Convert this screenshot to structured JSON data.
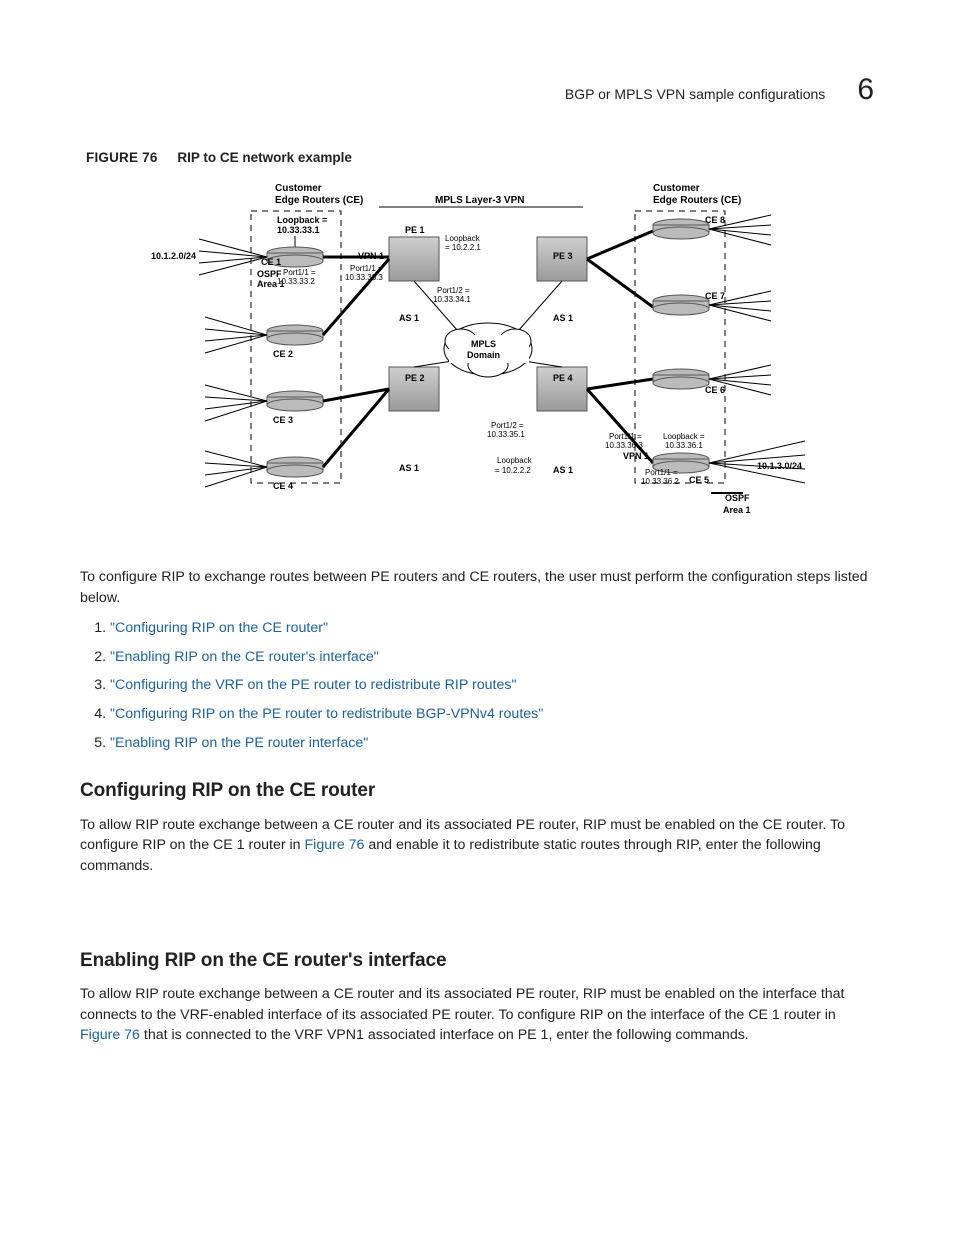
{
  "header": {
    "title": "BGP or MPLS VPN sample configurations",
    "chapter": "6"
  },
  "figure": {
    "label": "FIGURE 76",
    "title": "RIP to CE network example",
    "labels": {
      "ce_header_left": "Customer\nEdge Routers (CE)",
      "ce_header_right": "Customer\nEdge Routers (CE)",
      "mpls_l3": "MPLS Layer-3 VPN",
      "loopback_left": "Loopback =\n10.33.33.1",
      "net_left": "10.1.2.0/24",
      "ospf_area_left": "OSPF\nArea 1",
      "ce1": "CE 1",
      "ce2": "CE 2",
      "ce3": "CE 3",
      "ce4": "CE 4",
      "ce5": "CE 5",
      "ce6": "CE 6",
      "ce7": "CE 7",
      "ce8": "CE 8",
      "ce1_port": "Port1/1 =\n10.33.33.2",
      "vpn1_left": "VPN 1",
      "pe1_port11": "Port1/1 =\n10.33.33.3",
      "pe1": "PE 1",
      "pe1_loop": "Loopback\n= 10.2.2.1",
      "pe1_port12": "Port1/2 =\n10.33.34.1",
      "as1_ul": "AS 1",
      "as1_ll": "AS 1",
      "as1_ur": "AS 1",
      "as1_lr": "AS 1",
      "pe2": "PE 2",
      "pe3": "PE 3",
      "pe4": "PE 4",
      "mpls_domain": "MPLS\nDomain",
      "pe2_port12": "Port1/2 =\n10.33.35.1",
      "pe2_loop": "Loopback\n= 10.2.2.2",
      "vpn1_right": "VPN 1",
      "ce5_port363": "Port1/1 =\n10.33.36.3",
      "ce5_port362": "Port1/1 =\n10.33.36.2",
      "loopback_right": "Loopback =\n10.33.36.1",
      "net_right": "10.1.3.0/24",
      "ospf_area_right": "OSPF\nArea 1"
    }
  },
  "intro": "To configure RIP to exchange routes between PE routers and CE routers, the user must perform the configuration steps listed below.",
  "steps": [
    "\"Configuring RIP on the CE router\"",
    "\"Enabling RIP on the CE router's interface\"",
    "\"Configuring the VRF on the PE router to redistribute RIP routes\"",
    "\"Configuring RIP on the PE router to redistribute BGP-VPNv4 routes\"",
    "\"Enabling RIP on the PE router interface\""
  ],
  "sections": {
    "s1_title": "Configuring RIP on the CE router",
    "s1_body_a": "To allow RIP route exchange between a CE router and its associated PE router, RIP must be enabled on the CE router. To configure RIP on the CE 1 router in ",
    "s1_link": "Figure 76",
    "s1_body_b": " and enable it to redistribute static routes through RIP, enter the following commands.",
    "s2_title": "Enabling RIP on the CE router's interface",
    "s2_body_a": "To allow RIP route exchange between a CE router and its associated PE router, RIP must be enabled on the interface that connects to the VRF-enabled interface of its associated PE router. To configure RIP on the interface of the CE 1 router in ",
    "s2_link": "Figure 76",
    "s2_body_b": " that is connected to the VRF VPN1 associated interface on PE 1, enter the following commands."
  }
}
